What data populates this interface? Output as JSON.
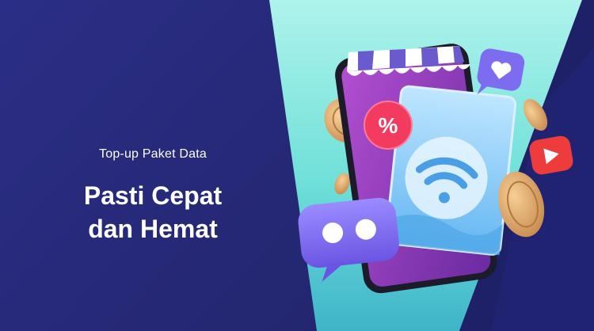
{
  "banner": {
    "subtitle": "Top-up Paket Data",
    "headline_line1": "Pasti Cepat",
    "headline_line2": "dan Hemat"
  },
  "illustration": {
    "discount_badge": "%",
    "icons": [
      "smartphone-icon",
      "shop-awning-icon",
      "wifi-card-icon",
      "percent-badge-icon",
      "heart-chat-icon",
      "play-button-icon",
      "chat-bubble-icon",
      "coin-icon"
    ]
  },
  "colors": {
    "background": "#1e1f66",
    "panel": "#26297a",
    "beam": "#7ee8e0",
    "phone_screen": "#8d3ab8",
    "badge": "#f23b5f",
    "chat_bubble": "#7d6cf0",
    "play": "#ee3c3c",
    "coin": "#d9a066"
  }
}
